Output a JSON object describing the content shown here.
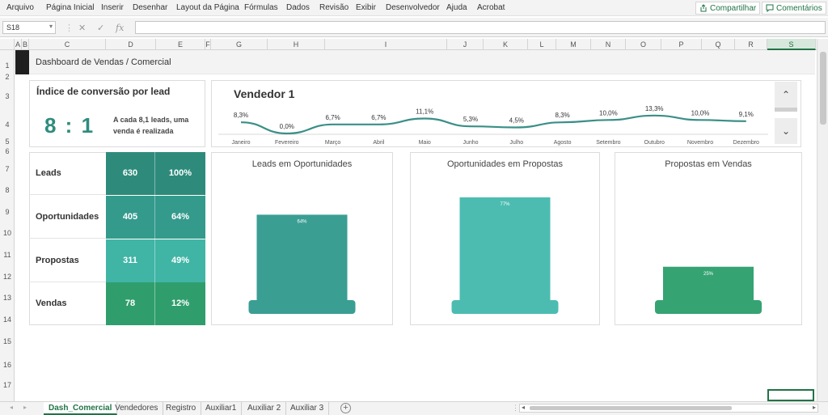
{
  "menu": {
    "items": [
      "Arquivo",
      "Página Inicial",
      "Inserir",
      "Desenhar",
      "Layout da Página",
      "Fórmulas",
      "Dados",
      "Revisão",
      "Exibir",
      "Desenvolvedor",
      "Ajuda",
      "Acrobat"
    ],
    "share_label": "Compartilhar",
    "comments_label": "Comentários"
  },
  "formula_bar": {
    "name_box": "S18",
    "fx": "fx",
    "formula": ""
  },
  "columns": [
    "A",
    "B",
    "C",
    "D",
    "E",
    "F",
    "G",
    "H",
    "I",
    "J",
    "K",
    "L",
    "M",
    "N",
    "O",
    "P",
    "Q",
    "R",
    "S"
  ],
  "selected_column": "S",
  "rows": [
    "1",
    "2",
    "3",
    "4",
    "5",
    "6",
    "7",
    "8",
    "9",
    "10",
    "11",
    "12",
    "13",
    "14",
    "15",
    "16",
    "17"
  ],
  "dashboard": {
    "title": "Dashboard de Vendas / Comercial",
    "conversion": {
      "title": "Índice de conversão por lead",
      "ratio": "8 : 1",
      "description": "A cada 8,1 leads, uma venda é realizada"
    },
    "seller": {
      "title": "Vendedor 1",
      "up_icon": "^",
      "down_icon": "ˇ"
    },
    "funnel": [
      {
        "label": "Leads",
        "value": "630",
        "pct": "100%",
        "color": "#2e8b7c"
      },
      {
        "label": "Oportunidades",
        "value": "405",
        "pct": "64%",
        "color": "#349a8c"
      },
      {
        "label": "Propostas",
        "value": "311",
        "pct": "49%",
        "color": "#40b5a5"
      },
      {
        "label": "Vendas",
        "value": "78",
        "pct": "12%",
        "color": "#2f9e6c"
      }
    ]
  },
  "chart_data": [
    {
      "type": "line",
      "title": "Vendedor 1",
      "categories": [
        "Janeiro",
        "Fevereiro",
        "Março",
        "Abril",
        "Maio",
        "Junho",
        "Julho",
        "Agosto",
        "Setembro",
        "Outubro",
        "Novembro",
        "Dezembro"
      ],
      "values": [
        8.3,
        0.0,
        6.7,
        6.7,
        11.1,
        5.3,
        4.5,
        8.3,
        10.0,
        13.3,
        10.0,
        9.1
      ],
      "labels": [
        "8,3%",
        "0,0%",
        "6,7%",
        "6,7%",
        "11,1%",
        "5,3%",
        "4,5%",
        "8,3%",
        "10,0%",
        "13,3%",
        "10,0%",
        "9,1%"
      ],
      "ylim": [
        0,
        15
      ],
      "color": "#3a8f86"
    },
    {
      "type": "bar",
      "title": "Leads em Oportunidades",
      "values": [
        64
      ],
      "labels": [
        "64%"
      ],
      "ylim": [
        0,
        100
      ],
      "color": "#3a9e93",
      "base_color": "#3a9e93"
    },
    {
      "type": "bar",
      "title": "Oportunidades em Propostas",
      "values": [
        77
      ],
      "labels": [
        "77%"
      ],
      "ylim": [
        0,
        100
      ],
      "color": "#4cbcb1",
      "base_color": "#4cbcb1"
    },
    {
      "type": "bar",
      "title": "Propostas em Vendas",
      "values": [
        25
      ],
      "labels": [
        "25%"
      ],
      "ylim": [
        0,
        100
      ],
      "color": "#35a372",
      "base_color": "#35a372"
    }
  ],
  "sheet_tabs": {
    "items": [
      "Dash_Comercial",
      "Vendedores",
      "Registro",
      "Auxiliar1",
      "Auxiliar 2",
      "Auxiliar 3"
    ],
    "active": "Dash_Comercial",
    "add_icon": "+"
  }
}
